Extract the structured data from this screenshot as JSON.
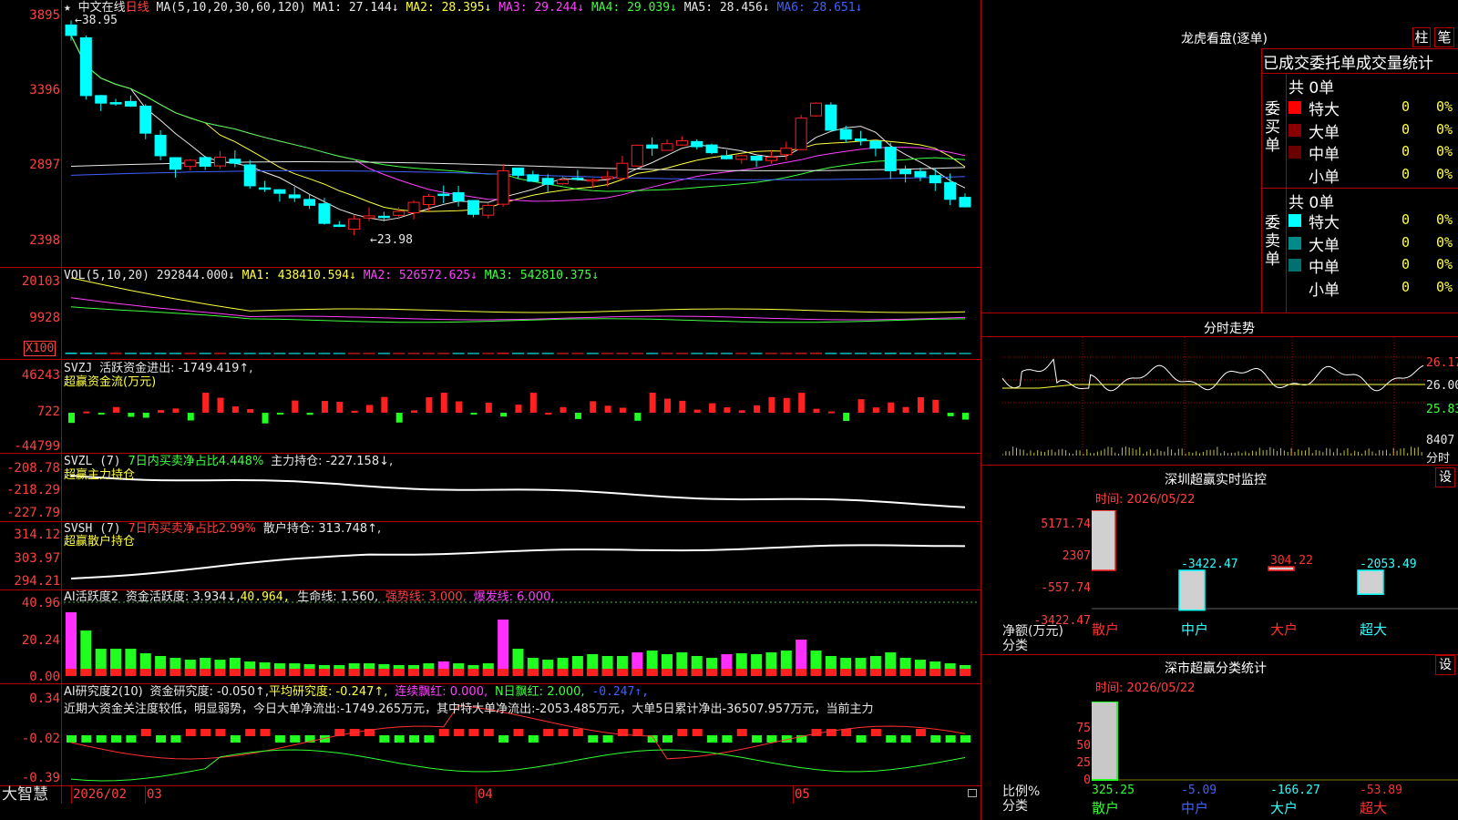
{
  "main": {
    "star": "★",
    "name": "中文在线",
    "period": "日线",
    "ma_title": "MA(5,10,20,30,60,120)",
    "ma": [
      {
        "label": "MA1: 27.144↓",
        "color": "#e8e8e8"
      },
      {
        "label": "MA2: 28.395↓",
        "color": "#ffff40"
      },
      {
        "label": "MA3: 29.244↓",
        "color": "#ff40ff"
      },
      {
        "label": "MA4: 29.039↓",
        "color": "#40ff40"
      },
      {
        "label": "MA5: 28.456↓",
        "color": "#e8e8e8"
      },
      {
        "label": "MA6: 28.651↓",
        "color": "#4060ff"
      }
    ],
    "axis": [
      "3895",
      "3396",
      "2897",
      "2398"
    ],
    "high_mark": "38.95",
    "low_mark": "23.98"
  },
  "vol": {
    "title": "VOL(5,10,20)",
    "v1": "292844.000↓",
    "v2": "MA1: 438410.594↓",
    "v3": "MA2: 526572.625↓",
    "v4": "MA3: 542810.375↓",
    "axis": [
      "20103",
      "9928"
    ],
    "unit": "X100"
  },
  "svzj": {
    "title": "SVZJ",
    "t1": "活跃资金进出: -1749.419↑,",
    "t2": "超赢资金流(万元)",
    "axis": [
      "46243",
      "722",
      "-44799"
    ]
  },
  "svzl": {
    "title": "SVZL (7)",
    "t1": "7日内买卖净占比4.448%",
    "t2": "主力持仓: -227.158↓,",
    "t3": "超赢主力持仓",
    "axis": [
      "-208.78",
      "-218.29",
      "-227.79"
    ]
  },
  "svsh": {
    "title": "SVSH (7)",
    "t1": "7日内买卖净占比2.99%",
    "t2": "散户持仓: 313.748↑,",
    "t3": "超赢散户持仓",
    "axis": [
      "314.12",
      "303.97",
      "294.21"
    ]
  },
  "ai1": {
    "title": "AI活跃度2",
    "t1": "资金活跃度: 3.934↓,",
    "t2": "40.964,",
    "t3": "生命线: 1.560,",
    "t4": "强势线: 3.000,",
    "t5": "爆发线: 6.000,",
    "axis": [
      "40.96",
      "20.24",
      "0.00"
    ]
  },
  "ai2": {
    "title": "AI研究度2(10)",
    "t1": "资金研究度: -0.050↑,",
    "t2": "平均研究度: -0.247↑,",
    "t3": "连续飘红: 0.000,",
    "t4": "N日飘红: 2.000,",
    "t5": "-0.247↑,",
    "note": "近期大资金关注度较低，明显弱势，今日大单净流出:-1749.265万元，其中特大单净流出:-2053.485万元，大单5日累计净出-36507.957万元，当前主力",
    "axis": [
      "0.34",
      "-0.02",
      "-0.39"
    ]
  },
  "bottom": {
    "brand": "大智慧",
    "dates": [
      "2026/02",
      "03",
      "04",
      "05"
    ]
  },
  "lhb": {
    "title": "龙虎看盘(逐单)",
    "btn1": "柱",
    "btn2": "笔",
    "header": "已成交委托单成交量统计",
    "buy_label": "委买单",
    "sell_label": "委卖单",
    "buy_total": "共 0单",
    "sell_total": "共 0单",
    "buy_rows": [
      {
        "name": "特大",
        "count": "0",
        "pct": "0%",
        "color": "#ff0000"
      },
      {
        "name": "大单",
        "count": "0",
        "pct": "0%",
        "color": "#8a0000"
      },
      {
        "name": "中单",
        "count": "0",
        "pct": "0%",
        "color": "#6a0000"
      },
      {
        "name": "小单",
        "count": "0",
        "pct": "0%",
        "color": "#000000"
      }
    ],
    "sell_rows": [
      {
        "name": "特大",
        "count": "0",
        "pct": "0%",
        "color": "#00ffff"
      },
      {
        "name": "大单",
        "count": "0",
        "pct": "0%",
        "color": "#008a8a"
      },
      {
        "name": "中单",
        "count": "0",
        "pct": "0%",
        "color": "#007070"
      },
      {
        "name": "小单",
        "count": "0",
        "pct": "0%",
        "color": "#000000"
      }
    ]
  },
  "fenshi": {
    "title": "分时走势",
    "p1": "26.17",
    "p2": "26.00",
    "p3": "25.83",
    "vol": "8407",
    "vol_unit": "分时"
  },
  "sz_monitor": {
    "title": "深圳超赢实时监控",
    "settings": "设",
    "time": "时间: 2026/05/22",
    "axis": [
      "5171.74",
      "2307",
      "-557.74",
      "-3422.47"
    ],
    "ylabel1": "净额(万元)",
    "ylabel2": "分类",
    "bars": [
      {
        "cat": "散户",
        "value": "5171.74",
        "num": 5171.74
      },
      {
        "cat": "中户",
        "value": "-3422.47",
        "num": -3422.47
      },
      {
        "cat": "大户",
        "value": "304.22",
        "num": 304.22
      },
      {
        "cat": "超大",
        "value": "-2053.49",
        "num": -2053.49
      }
    ]
  },
  "sz_class": {
    "title": "深市超赢分类统计",
    "settings": "设",
    "time": "时间: 2026/05/22",
    "axis": [
      "75",
      "50",
      "25",
      "0"
    ],
    "ylabel1": "比例%",
    "ylabel2": "分类",
    "bars": [
      {
        "cat": "散户",
        "value": "325.25",
        "num": 100
      },
      {
        "cat": "中户",
        "value": "-5.09",
        "num": 0
      },
      {
        "cat": "大户",
        "value": "-166.27",
        "num": 0
      },
      {
        "cat": "超大",
        "value": "-53.89",
        "num": 0
      }
    ]
  }
}
